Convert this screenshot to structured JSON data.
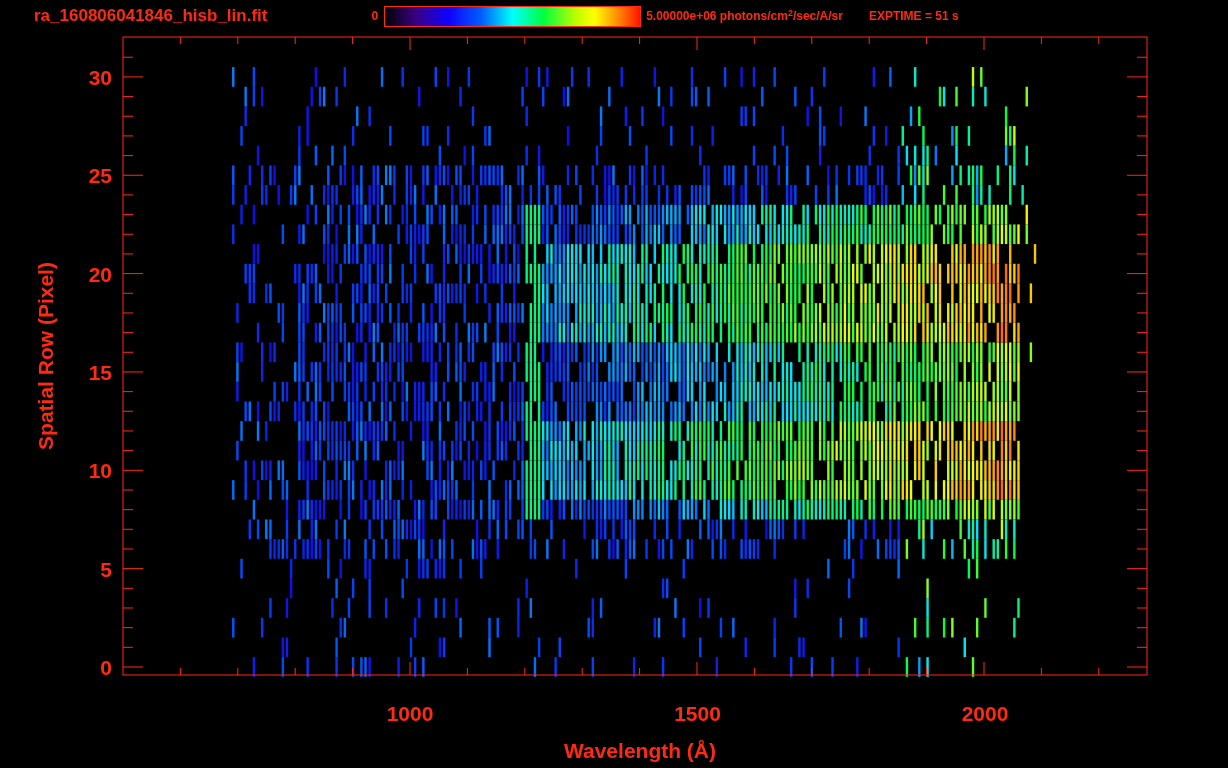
{
  "title": "ra_160806041846_hisb_lin.fit",
  "colorbar": {
    "min_label": "0",
    "max_label": "5.00000e+06 photons/cm$^{2}$/sec/A/sr"
  },
  "exposure": "EXPTIME = 51 s",
  "plot": {
    "xlabel": "Wavelength (Å)",
    "ylabel": "Spatial Row (Pixel)",
    "xticks": [
      "1000",
      "1500",
      "2000"
    ],
    "yticks": [
      "30",
      "25",
      "20",
      "15",
      "10",
      "5",
      "0"
    ]
  }
}
